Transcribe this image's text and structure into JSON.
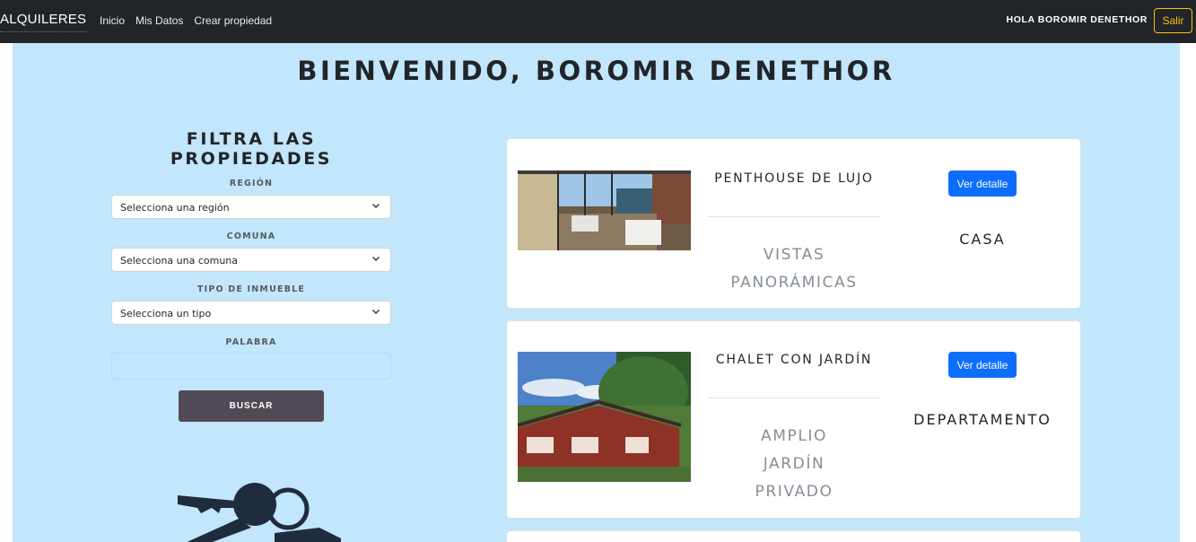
{
  "navbar": {
    "brand": "ALQUILERES",
    "links": [
      "Inicio",
      "Mis Datos",
      "Crear propiedad"
    ],
    "greeting": "HOLA BOROMIR DENETHOR",
    "logout_label": "Salir"
  },
  "main": {
    "welcome": "BIENVENIDO, BOROMIR DENETHOR"
  },
  "filter": {
    "title": "FILTRA LAS PROPIEDADES",
    "region_label": "REGIÓN",
    "region_value": "Selecciona una región",
    "comuna_label": "COMUNA",
    "comuna_value": "Selecciona una comuna",
    "tipo_label": "TIPO DE INMUEBLE",
    "tipo_value": "Selecciona un tipo",
    "palabra_label": "PALABRA",
    "palabra_value": "",
    "search_label": "BUSCAR"
  },
  "properties": [
    {
      "title": "PENTHOUSE DE LUJO",
      "description_lines": [
        "VISTAS",
        "PANORÁMICAS"
      ],
      "detail_label": "Ver detalle",
      "type": "CASA"
    },
    {
      "title": "CHALET CON JARDÍN",
      "description_lines": [
        "AMPLIO",
        "JARDÍN",
        "PRIVADO"
      ],
      "detail_label": "Ver detalle",
      "type": "DEPARTAMENTO"
    }
  ],
  "colors": {
    "navbar_bg": "#212529",
    "main_bg": "#c2e6fb",
    "primary": "#0d6efd",
    "warning": "#ffc107",
    "search_button": "#514a54"
  },
  "icons": [
    "chevron-down-icon",
    "keys-icon"
  ]
}
